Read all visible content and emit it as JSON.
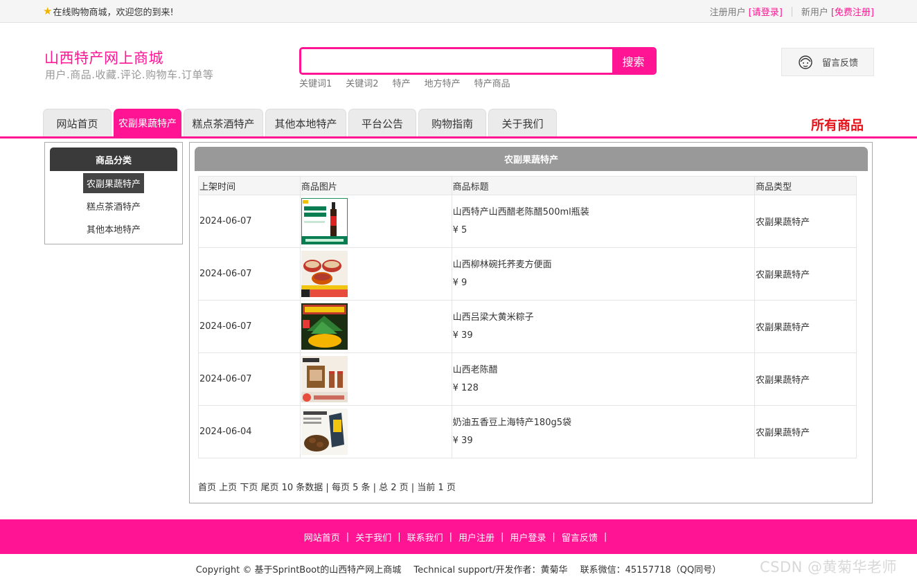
{
  "topbar": {
    "welcome": "在线购物商城，欢迎您的到来!",
    "register_label": "注册用户",
    "login_link": "[请登录]",
    "new_user_label": "新用户",
    "signup_link": "[免费注册]"
  },
  "header": {
    "title": "山西特产网上商城",
    "subtitle": "用户.商品.收藏.评论.购物车.订单等",
    "search_placeholder": "",
    "search_button": "搜索",
    "keywords": [
      "关键词1",
      "关键词2",
      "特产",
      "地方特产",
      "特产商品"
    ],
    "feedback": "留言反馈"
  },
  "nav": {
    "tabs": [
      {
        "label": "网站首页",
        "active": false
      },
      {
        "label": "农副果蔬特产",
        "active": true
      },
      {
        "label": "糕点茶酒特产",
        "active": false
      },
      {
        "label": "其他本地特产",
        "active": false
      },
      {
        "label": "平台公告",
        "active": false
      },
      {
        "label": "购物指南",
        "active": false
      },
      {
        "label": "关于我们",
        "active": false
      }
    ],
    "all_goods": "所有商品"
  },
  "sidebar": {
    "title": "商品分类",
    "items": [
      {
        "label": "农副果蔬特产",
        "active": true
      },
      {
        "label": "糕点茶酒特产",
        "active": false
      },
      {
        "label": "其他本地特产",
        "active": false
      }
    ]
  },
  "main": {
    "title": "农副果蔬特产",
    "columns": [
      "上架时间",
      "商品图片",
      "商品标题",
      "商品类型"
    ],
    "rows": [
      {
        "date": "2024-06-07",
        "title": "山西特产山西醋老陈醋500ml瓶装",
        "price": "¥ 5",
        "type": "农副果蔬特产",
        "image": "vinegar-bottle"
      },
      {
        "date": "2024-06-07",
        "title": "山西柳林碗托荞麦方便面",
        "price": "¥ 9",
        "type": "农副果蔬特产",
        "image": "noodle-bowls"
      },
      {
        "date": "2024-06-07",
        "title": "山西吕梁大黄米粽子",
        "price": "¥ 39",
        "type": "农副果蔬特产",
        "image": "rice-dumpling"
      },
      {
        "date": "2024-06-07",
        "title": "山西老陈醋",
        "price": "¥ 128",
        "type": "农副果蔬特产",
        "image": "vinegar-giftbox"
      },
      {
        "date": "2024-06-04",
        "title": "奶油五香豆上海特产180g5袋",
        "price": "¥ 39",
        "type": "农副果蔬特产",
        "image": "spiced-beans"
      }
    ],
    "pager": {
      "first": "首页",
      "prev": "上页",
      "next": "下页",
      "last": "尾页",
      "summary": "10 条数据 | 每页 5 条 | 总 2 页 | 当前 1 页"
    }
  },
  "footer": {
    "links": [
      "网站首页",
      "关于我们",
      "联系我们",
      "用户注册",
      "用户登录",
      "留言反馈"
    ],
    "copyright": "Copyright © 基于SprintBoot的山西特产网上商城",
    "support": "Technical support/开发作者：黄菊华",
    "contact": "联系微信：45157718（QQ同号）"
  },
  "watermark": "CSDN @黄菊华老师",
  "colors": {
    "accent": "#ff1493",
    "all_goods": "#e8141c",
    "sidebar_head": "#3a3a3a",
    "panel_head": "#999999"
  }
}
